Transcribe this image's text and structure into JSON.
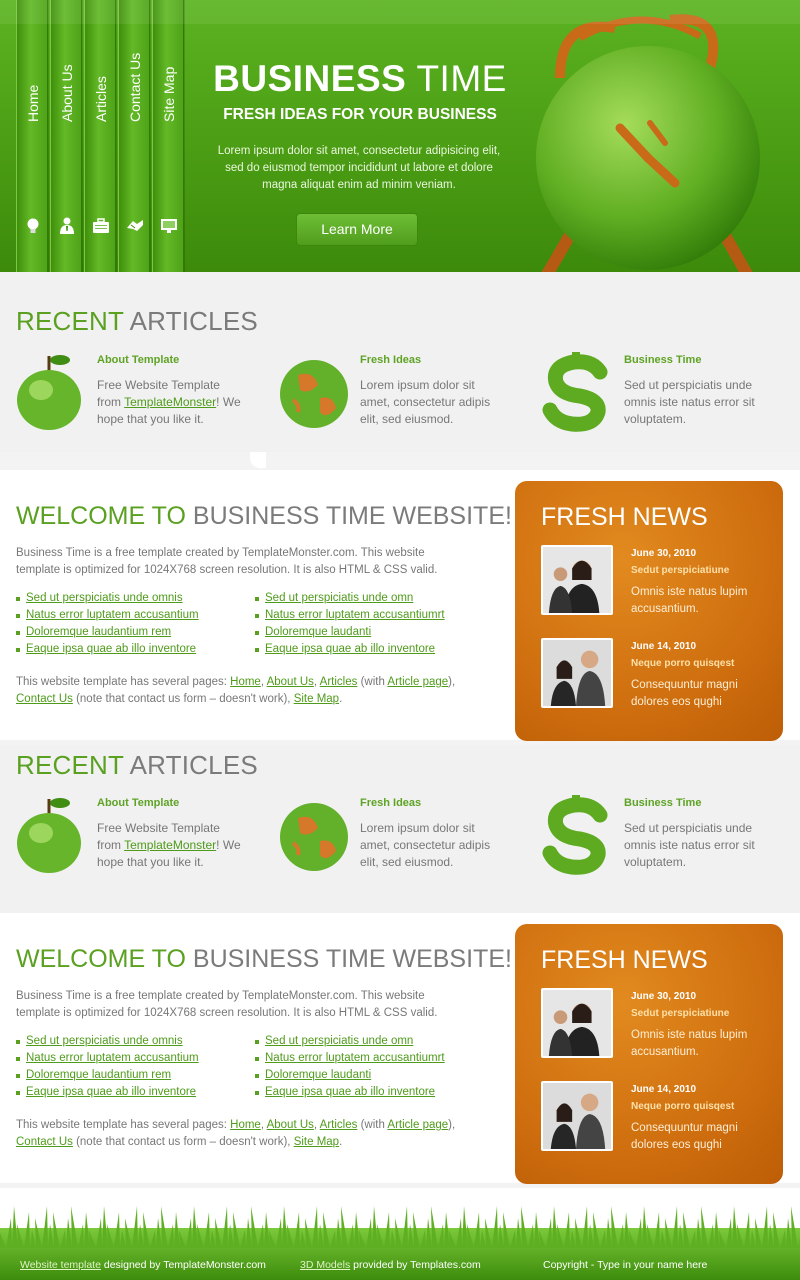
{
  "header": {
    "nav": [
      {
        "label": "Home",
        "icon": "lightbulb-icon"
      },
      {
        "label": "About Us",
        "icon": "person-icon"
      },
      {
        "label": "Articles",
        "icon": "briefcase-icon"
      },
      {
        "label": "Contact Us",
        "icon": "handshake-icon"
      },
      {
        "label": "Site Map",
        "icon": "monitor-icon"
      }
    ],
    "brand_bold": "BUSINESS",
    "brand_light": "TIME",
    "subtitle": "FRESH IDEAS FOR YOUR BUSINESS",
    "text": "Lorem ipsum dolor sit amet, consectetur adipisicing elit, sed do eiusmod tempor incididunt ut labore et dolore magna aliquat enim ad minim veniam.",
    "button": "Learn More"
  },
  "articles": {
    "title_green": "RECENT",
    "title_gray": "ARTICLES",
    "items": [
      {
        "title": "About Template",
        "text_before": "Free Website Template from ",
        "link": "TemplateMonster",
        "text_after": "! We hope that you like it.",
        "icon": "green-apple-icon"
      },
      {
        "title": "Fresh Ideas",
        "text": "Lorem ipsum dolor sit amet, consectetur adipis elit, sed eiusmod.",
        "icon": "grass-globe-icon"
      },
      {
        "title": "Business Time",
        "text": "Sed ut perspiciatis unde omnis iste natus error sit voluptatem.",
        "icon": "grass-dollar-icon"
      }
    ]
  },
  "welcome": {
    "title_green": "WELCOME TO",
    "title_gray": "BUSINESS TIME WEBSITE!",
    "intro": "Business Time is a free template created by TemplateMonster.com. This website template is optimized for 1024X768 screen resolution. It is also HTML & CSS valid.",
    "list_left": [
      "Sed ut perspiciatis unde omnis",
      "Natus error luptatem accusantium",
      "Doloremque laudantium rem",
      "Eaque ipsa quae ab illo inventore"
    ],
    "list_right": [
      "Sed ut perspiciatis unde omn",
      "Natus error luptatem accusantiumrt",
      "Doloremque laudanti",
      "Eaque ipsa quae ab illo inventore"
    ],
    "pages": {
      "prefix": "This website template has several pages: ",
      "home": "Home",
      "about": "About Us",
      "articles": "Articles",
      "with": " (with ",
      "article_page": "Article page",
      "close": "),",
      "contact": "Contact Us",
      "note": " (note that contact us form – doesn't work), ",
      "sitemap": "Site Map",
      "end": "."
    }
  },
  "news": {
    "title": "FRESH NEWS",
    "items": [
      {
        "date": "June 30, 2010",
        "headline": "Sedut perspiciatiune",
        "text": "Omnis iste natus lupim accusantium."
      },
      {
        "date": "June 14, 2010",
        "headline": "Neque porro quisqest",
        "text": "Consequuntur magni dolores eos qughi"
      }
    ]
  },
  "footer": {
    "link1": "Website template",
    "text1": " designed by TemplateMonster.com",
    "link2": "3D Models",
    "text2": " provided by Templates.com",
    "copyright": "Copyright - Type in your name here"
  },
  "colors": {
    "green": "#5aa021",
    "orange": "#d2720f",
    "gray": "#7b7b7b"
  }
}
